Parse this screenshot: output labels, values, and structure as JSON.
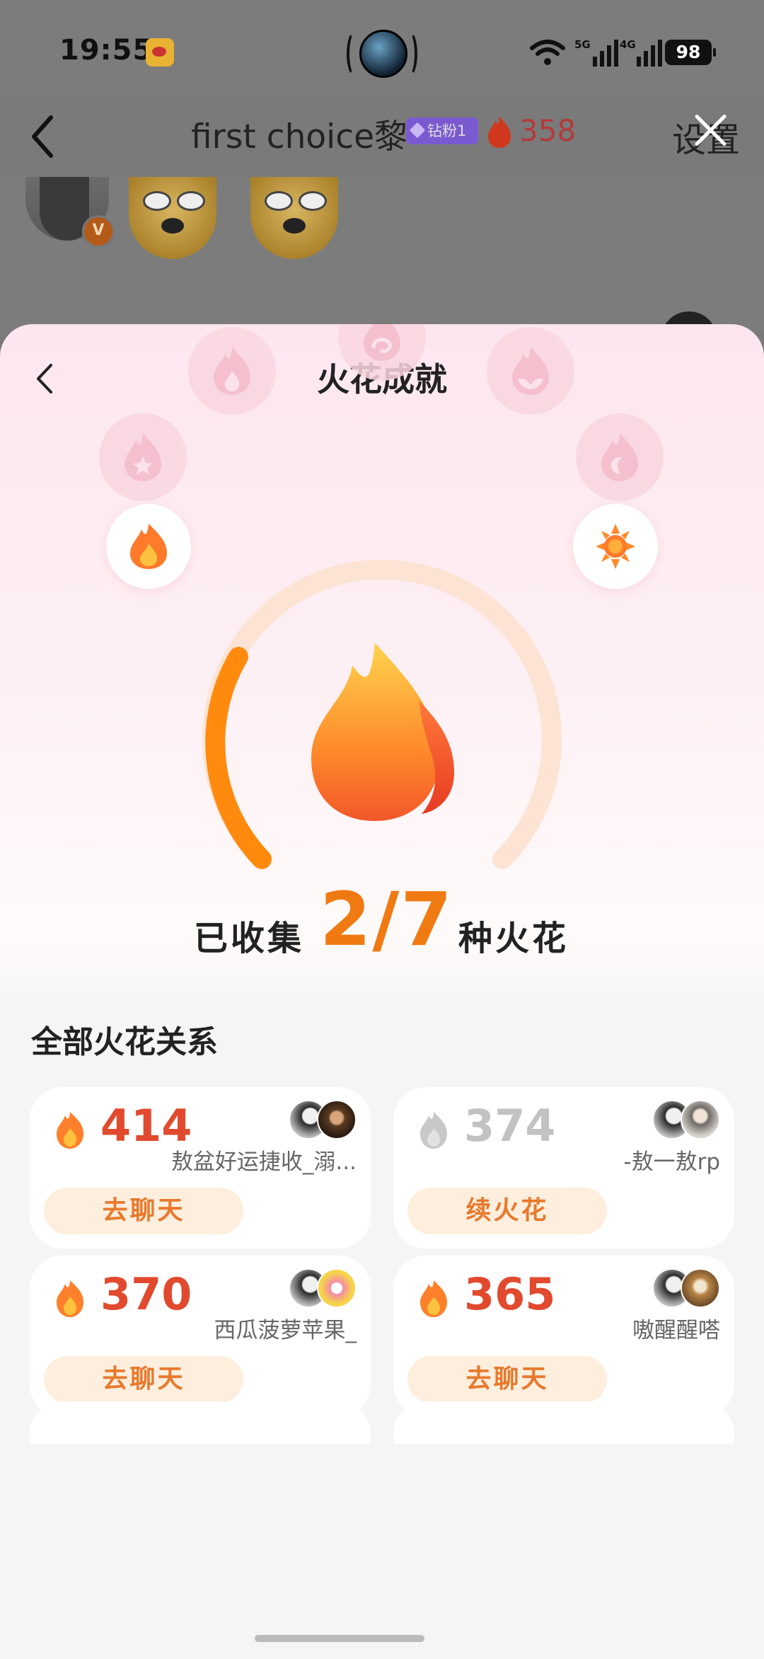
{
  "status_bar": {
    "time": "19:55",
    "network_1": "5G",
    "network_2": "4G",
    "battery": "98",
    "icons": [
      "weibo-icon",
      "camera-icon",
      "wifi-icon",
      "signal-icon",
      "battery-icon"
    ]
  },
  "background_chat": {
    "title": "first choice黎",
    "fan_badge": "钻粉1",
    "spark_count": "358",
    "settings_label": "设置",
    "icons": [
      "back-chevron-icon",
      "fire-icon",
      "close-icon",
      "verified-v-icon"
    ],
    "verified_label": "V"
  },
  "sheet": {
    "title": "火花成就",
    "collect_prefix": "已收集",
    "collect_count": "2/7",
    "collect_suffix": "种火花",
    "section_title": "全部火花关系"
  },
  "cards": [
    {
      "score": "414",
      "name": "敖盆好运捷收_溺...",
      "action": "去聊天",
      "active": true
    },
    {
      "score": "374",
      "name": "-敖一敖rp",
      "action": "续火花",
      "active": false
    },
    {
      "score": "370",
      "name": "西瓜菠萝苹果_",
      "action": "去聊天",
      "active": true
    },
    {
      "score": "365",
      "name": "嗷醒醒嗒",
      "action": "去聊天",
      "active": true
    }
  ],
  "colors": {
    "accent_orange": "#f07a12",
    "score_red": "#e14a2e",
    "button_bg": "#fdeedd",
    "button_text": "#e8792c",
    "inactive_grey": "#c2c2c2"
  }
}
